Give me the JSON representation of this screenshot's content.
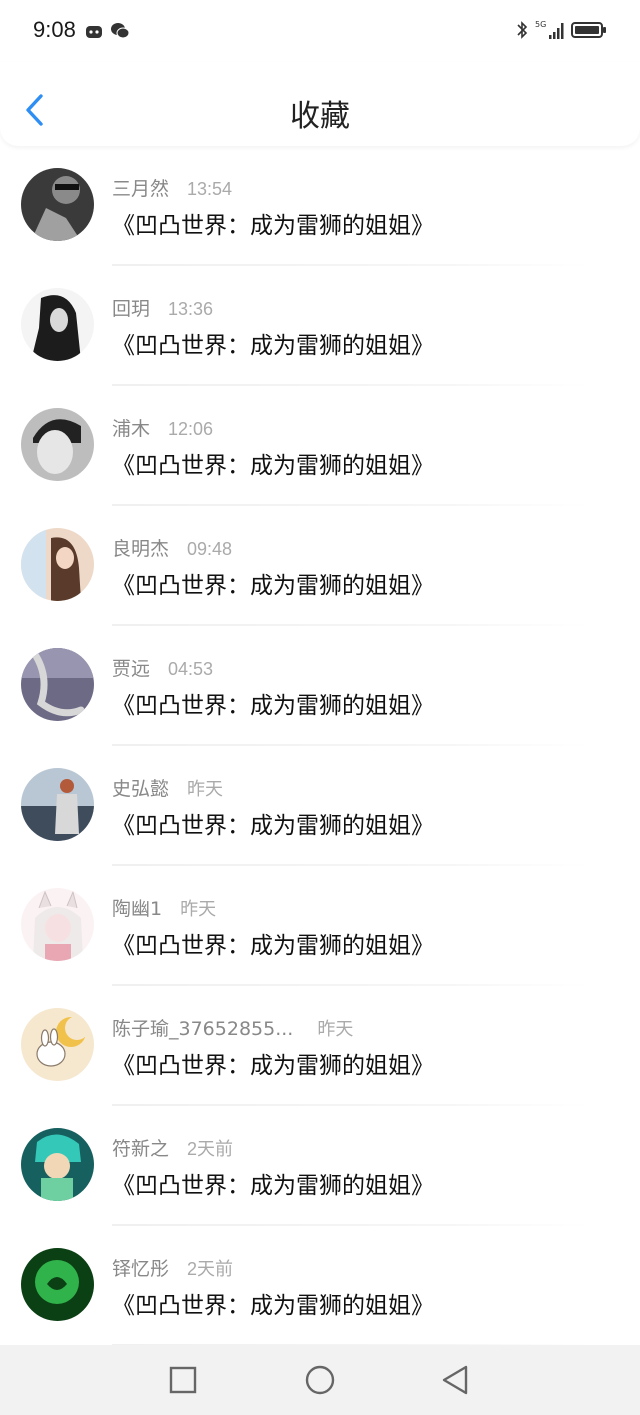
{
  "status_bar": {
    "time": "9:08"
  },
  "header": {
    "title": "收藏"
  },
  "items": [
    {
      "username": "三月然",
      "time": "13:54",
      "title": "《凹凸世界：成为雷狮的姐姐》",
      "avatar_color": "#4a4a4a"
    },
    {
      "username": "回玥",
      "time": "13:36",
      "title": "《凹凸世界：成为雷狮的姐姐》",
      "avatar_color": "#2a2a2a"
    },
    {
      "username": "浦木",
      "time": "12:06",
      "title": "《凹凸世界：成为雷狮的姐姐》",
      "avatar_color": "#9a9a9a"
    },
    {
      "username": "良明杰",
      "time": "09:48",
      "title": "《凹凸世界：成为雷狮的姐姐》",
      "avatar_color": "#d9b7a2"
    },
    {
      "username": "贾远",
      "time": "04:53",
      "title": "《凹凸世界：成为雷狮的姐姐》",
      "avatar_color": "#6d6a86"
    },
    {
      "username": "史弘懿",
      "time": "昨天",
      "title": "《凹凸世界：成为雷狮的姐姐》",
      "avatar_color": "#7f8a99"
    },
    {
      "username": "陶幽1",
      "time": "昨天",
      "title": "《凹凸世界：成为雷狮的姐姐》",
      "avatar_color": "#f1d4d8"
    },
    {
      "username": "陈子瑜_37652855...",
      "time": "昨天",
      "title": "《凹凸世界：成为雷狮的姐姐》",
      "avatar_color": "#f6e7cf"
    },
    {
      "username": "符新之",
      "time": "2天前",
      "title": "《凹凸世界：成为雷狮的姐姐》",
      "avatar_color": "#1c7d7b"
    },
    {
      "username": "铎忆彤",
      "time": "2天前",
      "title": "《凹凸世界：成为雷狮的姐姐》",
      "avatar_color": "#0f5a1c"
    }
  ],
  "colors": {
    "accent": "#2f8ef4",
    "divider": "#f0f0f0",
    "nav_bg": "#f2f2f2"
  }
}
